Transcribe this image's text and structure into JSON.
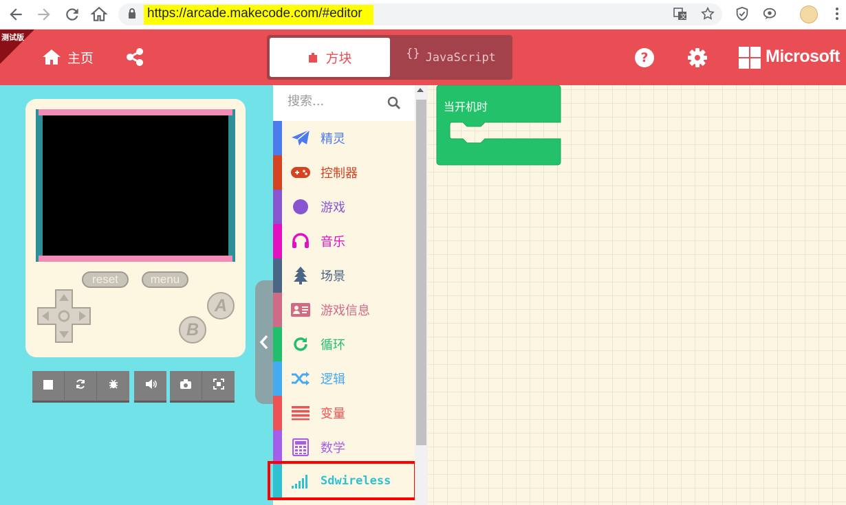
{
  "browser": {
    "url": "https://arcade.makecode.com/#editor",
    "icons": [
      "back-icon",
      "forward-icon",
      "reload-icon",
      "home-icon",
      "lock-icon",
      "translate-icon",
      "star-icon",
      "shield-icon",
      "chat-icon",
      "avatar",
      "kebab-menu-icon"
    ]
  },
  "header": {
    "beta_label": "测试版",
    "home_label": "主页",
    "blocks_label": "方块",
    "javascript_label": "JavaScript",
    "braces": "{}",
    "help_glyph": "?",
    "brand": "Microsoft"
  },
  "simulator": {
    "reset_label": "reset",
    "menu_label": "menu",
    "a_label": "A",
    "b_label": "B",
    "tools": [
      "stop-icon",
      "restart-icon",
      "debug-icon",
      "sound-icon",
      "screenshot-icon",
      "fullscreen-icon"
    ]
  },
  "toolbox": {
    "search_placeholder": "搜索...",
    "categories": [
      {
        "label": "精灵",
        "color": "#4b7bec",
        "icon": "paper-plane-icon"
      },
      {
        "label": "控制器",
        "color": "#d54322",
        "icon": "gamepad-icon"
      },
      {
        "label": "游戏",
        "color": "#8854d0",
        "icon": "circle-icon"
      },
      {
        "label": "音乐",
        "color": "#e30fc0",
        "icon": "headphones-icon"
      },
      {
        "label": "场景",
        "color": "#4b6584",
        "icon": "tree-icon"
      },
      {
        "label": "游戏信息",
        "color": "#cf6a87",
        "icon": "id-card-icon"
      },
      {
        "label": "循环",
        "color": "#20bf6b",
        "icon": "refresh-icon"
      },
      {
        "label": "逻辑",
        "color": "#45aaf2",
        "icon": "shuffle-icon"
      },
      {
        "label": "变量",
        "color": "#ee5253",
        "icon": "list-icon"
      },
      {
        "label": "数学",
        "color": "#a55eea",
        "icon": "calculator-icon"
      },
      {
        "label": "Sdwireless",
        "color": "#2fc1d0",
        "icon": "signal-bars-icon"
      }
    ]
  },
  "workspace": {
    "block_label": "当开机时",
    "block_color": "#23c16a"
  },
  "colors": {
    "header": "#e94e55",
    "simulator_bg": "#72e2e9",
    "highlight": "#ff0000"
  }
}
